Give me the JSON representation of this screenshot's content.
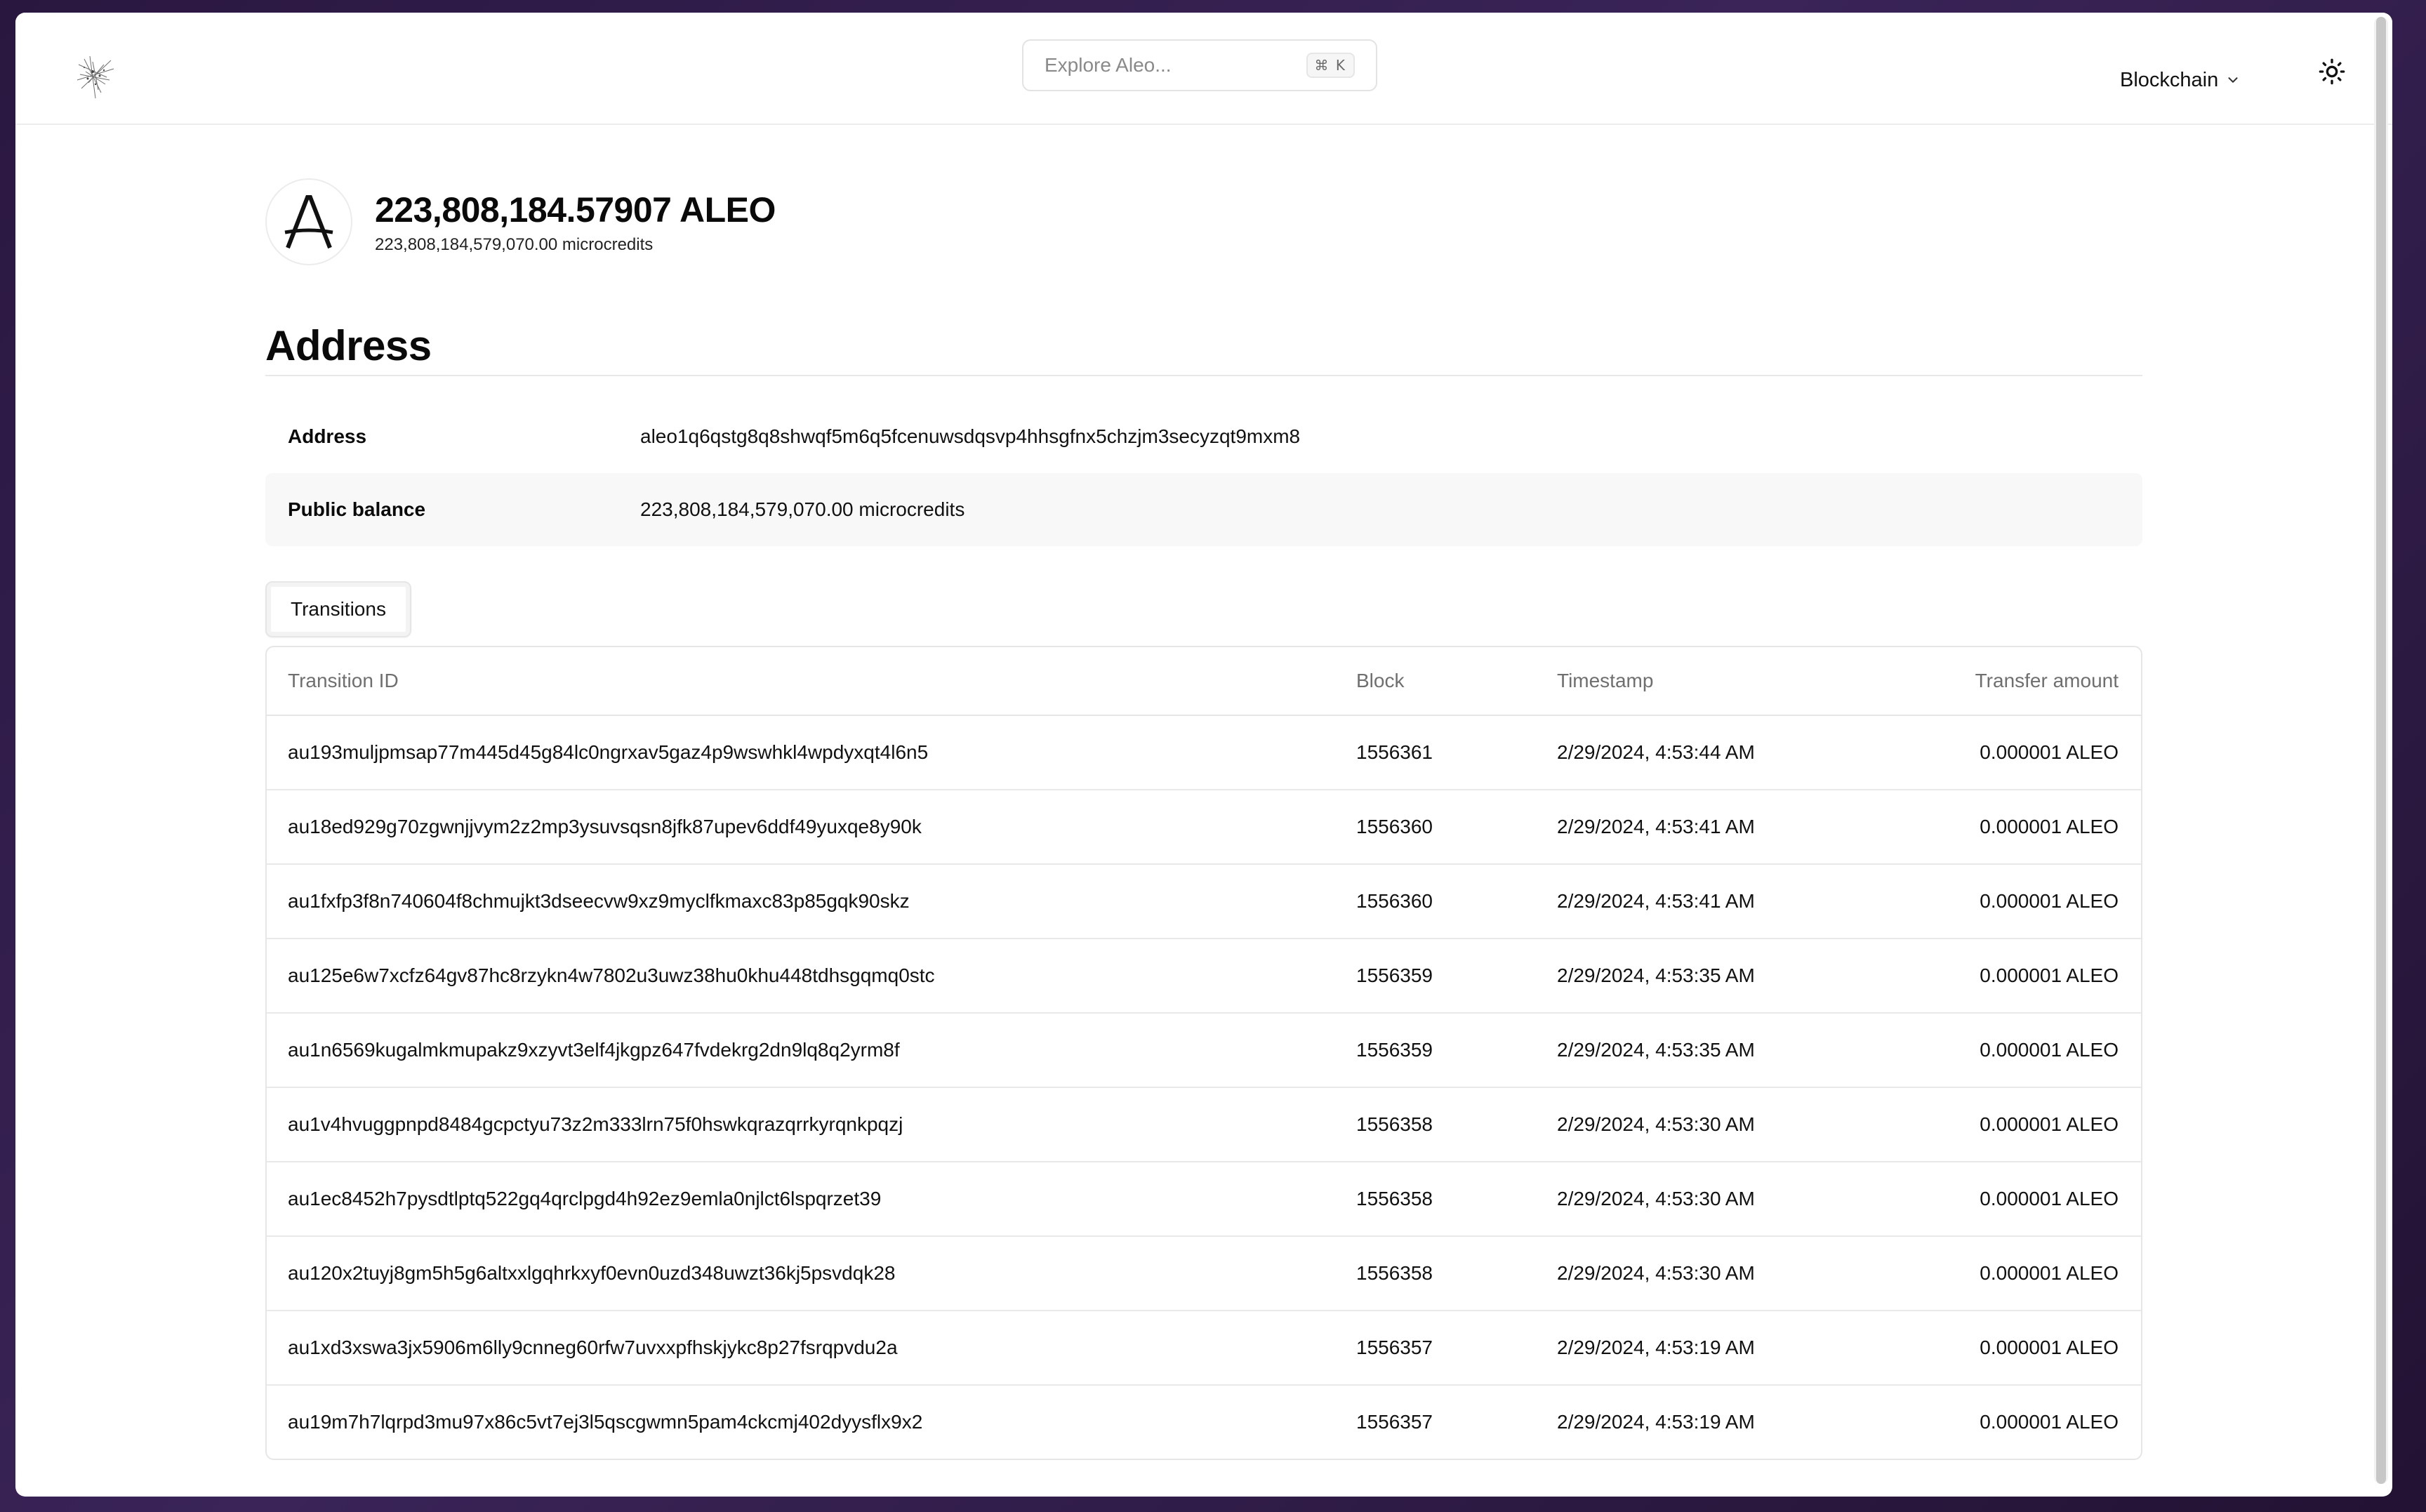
{
  "header": {
    "search_placeholder": "Explore Aleo...",
    "search_shortcut": "⌘ K",
    "nav_blockchain": "Blockchain"
  },
  "balance": {
    "aleo": "223,808,184.57907 ALEO",
    "microcredits": "223,808,184,579,070.00 microcredits",
    "logo_letter": "A"
  },
  "section": {
    "title": "Address"
  },
  "info": [
    {
      "label": "Address",
      "value": "aleo1q6qstg8q8shwqf5m6q5fcenuwsdqsvp4hhsgfnx5chzjm3secyzqt9mxm8"
    },
    {
      "label": "Public balance",
      "value": "223,808,184,579,070.00 microcredits"
    }
  ],
  "tabs": {
    "transitions": "Transitions"
  },
  "table": {
    "headers": [
      "Transition ID",
      "Block",
      "Timestamp",
      "Transfer amount"
    ],
    "rows": [
      [
        "au193muljpmsap77m445d45g84lc0ngrxav5gaz4p9wswhkl4wpdyxqt4l6n5",
        "1556361",
        "2/29/2024, 4:53:44 AM",
        "0.000001 ALEO"
      ],
      [
        "au18ed929g70zgwnjjvym2z2mp3ysuvsqsn8jfk87upev6ddf49yuxqe8y90k",
        "1556360",
        "2/29/2024, 4:53:41 AM",
        "0.000001 ALEO"
      ],
      [
        "au1fxfp3f8n740604f8chmujkt3dseecvw9xz9myclfkmaxc83p85gqk90skz",
        "1556360",
        "2/29/2024, 4:53:41 AM",
        "0.000001 ALEO"
      ],
      [
        "au125e6w7xcfz64gv87hc8rzykn4w7802u3uwz38hu0khu448tdhsgqmq0stc",
        "1556359",
        "2/29/2024, 4:53:35 AM",
        "0.000001 ALEO"
      ],
      [
        "au1n6569kugalmkmupakz9xzyvt3elf4jkgpz647fvdekrg2dn9lq8q2yrm8f",
        "1556359",
        "2/29/2024, 4:53:35 AM",
        "0.000001 ALEO"
      ],
      [
        "au1v4hvuggpnpd8484gcpctyu73z2m333lrn75f0hswkqrazqrrkyrqnkpqzj",
        "1556358",
        "2/29/2024, 4:53:30 AM",
        "0.000001 ALEO"
      ],
      [
        "au1ec8452h7pysdtlptq522gq4qrclpgd4h92ez9emla0njlct6lspqrzet39",
        "1556358",
        "2/29/2024, 4:53:30 AM",
        "0.000001 ALEO"
      ],
      [
        "au120x2tuyj8gm5h5g6altxxlgqhrkxyf0evn0uzd348uwzt36kj5psvdqk28",
        "1556358",
        "2/29/2024, 4:53:30 AM",
        "0.000001 ALEO"
      ],
      [
        "au1xd3xswa3jx5906m6lly9cnneg60rfw7uvxxpfhskjykc8p27fsrqpvdu2a",
        "1556357",
        "2/29/2024, 4:53:19 AM",
        "0.000001 ALEO"
      ],
      [
        "au19m7h7lqrpd3mu97x86c5vt7ej3l5qscgwmn5pam4ckcmj402dyysflx9x2",
        "1556357",
        "2/29/2024, 4:53:19 AM",
        "0.000001 ALEO"
      ]
    ]
  },
  "icons": {
    "logo": "aleo-explorer-logo",
    "chevron": "chevron-down-icon",
    "theme": "sun-icon"
  }
}
